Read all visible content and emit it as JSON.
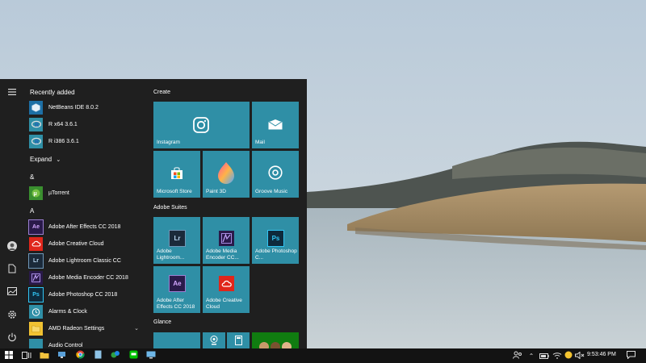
{
  "desktop": {
    "wallpaper": "lakeside-hills-grass"
  },
  "start_menu": {
    "rail": [
      {
        "name": "hamburger-menu-icon"
      },
      {
        "name": "user-avatar-icon"
      },
      {
        "name": "documents-icon"
      },
      {
        "name": "pictures-icon"
      },
      {
        "name": "settings-gear-icon"
      },
      {
        "name": "power-icon"
      }
    ],
    "recently_added_label": "Recently added",
    "recent_apps": [
      {
        "label": "NetBeans IDE 8.0.2",
        "icon": "netbeans-icon"
      },
      {
        "label": "R x64 3.6.1",
        "icon": "r-icon"
      },
      {
        "label": "R i386 3.6.1",
        "icon": "r-icon"
      }
    ],
    "expand_label": "Expand",
    "section_amp": "&",
    "utorrent_label": "µTorrent",
    "section_a": "A",
    "a_apps": [
      {
        "label": "Adobe After Effects CC 2018",
        "icon": "Ae",
        "bg": "#2a1a4a",
        "fg": "#d3a7ff"
      },
      {
        "label": "Adobe Creative Cloud",
        "icon": "Cc",
        "bg": "#e0261b",
        "fg": "#ffffff"
      },
      {
        "label": "Adobe Lightroom Classic CC",
        "icon": "Lr",
        "bg": "#1b2a3a",
        "fg": "#b7d4ee"
      },
      {
        "label": "Adobe Media Encoder CC 2018",
        "icon": "Me",
        "bg": "#2a1a4a",
        "fg": "#c8a8ff"
      },
      {
        "label": "Adobe Photoshop CC 2018",
        "icon": "Ps",
        "bg": "#0e2a3c",
        "fg": "#31c5f4"
      },
      {
        "label": "Alarms & Clock",
        "icon": "alarm-clock-icon",
        "bg": "#2f8fa6",
        "fg": "#ffffff"
      },
      {
        "label": "AMD Radeon Settings",
        "icon": "amd-folder-icon",
        "bg": "#f1c232",
        "fg": "#ffffff"
      },
      {
        "label": "Audio Control",
        "icon": "audio-icon",
        "bg": "#2f8fa6",
        "fg": "#ffffff"
      }
    ],
    "tile_groups": {
      "create": "Create",
      "adobe": "Adobe Suites",
      "glance": "Glance"
    },
    "tiles": {
      "instagram": "Instagram",
      "mail": "Mail",
      "store": "Microsoft Store",
      "paint3d": "Paint 3D",
      "groove": "Groove Music",
      "lightroom": "Adobe Lightroom...",
      "media_encoder": "Adobe Media Encoder CC...",
      "photoshop": "Adobe Photoshop C...",
      "after_effects": "Adobe After Effects CC 2018",
      "creative_cloud": "Adobe Creative Cloud"
    }
  },
  "taskbar": {
    "time": "9:53:46 PM",
    "tile_color": "#2f8fa6"
  }
}
